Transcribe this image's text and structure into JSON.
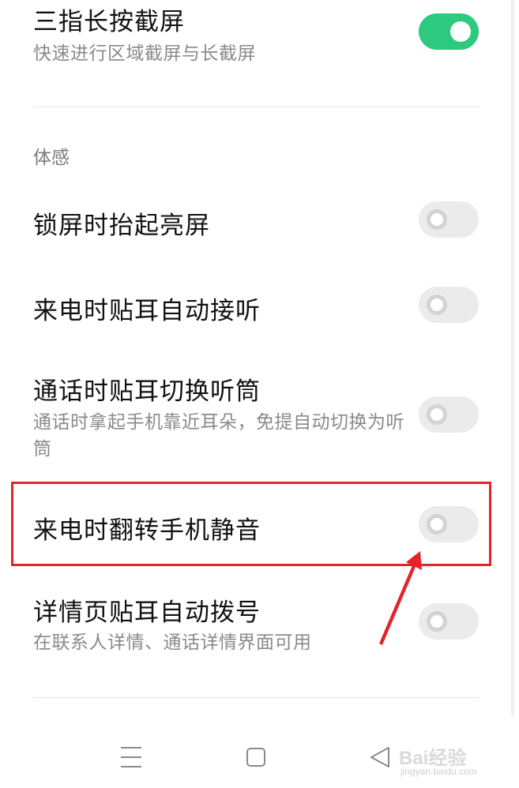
{
  "settings": {
    "three_finger": {
      "title": "三指长按截屏",
      "subtitle": "快速进行区域截屏与长截屏",
      "enabled": true
    },
    "section_header": "体感",
    "items": [
      {
        "title": "锁屏时抬起亮屏",
        "subtitle": "",
        "enabled": false
      },
      {
        "title": "来电时贴耳自动接听",
        "subtitle": "",
        "enabled": false
      },
      {
        "title": "通话时贴耳切换听筒",
        "subtitle": "通话时拿起手机靠近耳朵，免提自动切换为听筒",
        "enabled": false
      },
      {
        "title": "来电时翻转手机静音",
        "subtitle": "",
        "enabled": false
      },
      {
        "title": "详情页贴耳自动拨号",
        "subtitle": "在联系人详情、通话详情界面可用",
        "enabled": false
      }
    ]
  },
  "annotation": {
    "highlight_color": "#e3242b",
    "highlighted_item": "来电时翻转手机静音"
  },
  "navbar": {
    "icons": [
      "menu-icon",
      "home-icon",
      "back-icon"
    ]
  },
  "watermark": {
    "main": "Bai经验",
    "sub": "jingyan.baidu.com"
  },
  "colors": {
    "toggle_on": "#2dc97f",
    "toggle_off": "#ebebeb"
  }
}
